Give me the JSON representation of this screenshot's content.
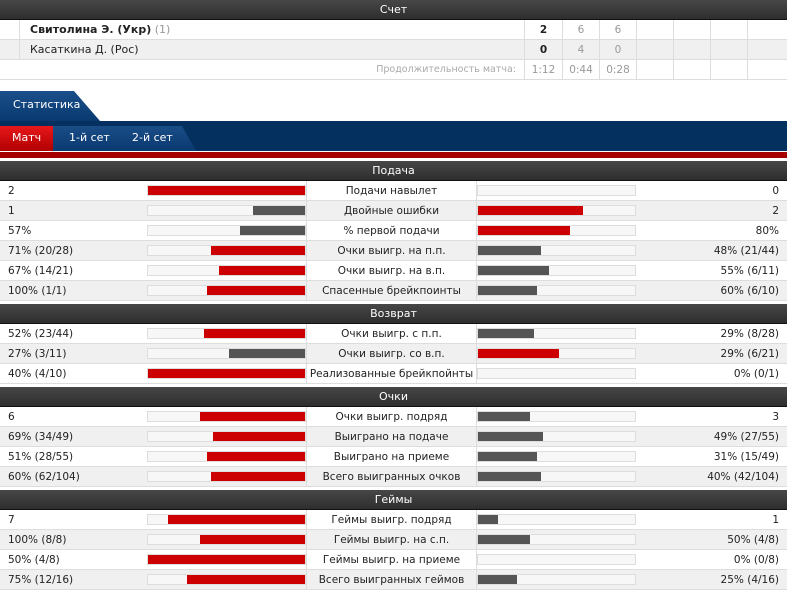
{
  "score": {
    "title": "Счет",
    "players": [
      {
        "name": "Свитолина Э. (Укр)",
        "seed": "(1)",
        "total": "2",
        "sets": [
          "6",
          "6"
        ]
      },
      {
        "name": "Касаткина Д. (Рос)",
        "seed": "",
        "total": "0",
        "sets": [
          "4",
          "0"
        ]
      }
    ],
    "duration_label": "Продолжительность матча:",
    "durations": [
      "1:12",
      "0:44",
      "0:28"
    ]
  },
  "tabs": {
    "main": "Статистика",
    "sub": [
      "Матч",
      "1-й сет",
      "2-й сет"
    ],
    "active_sub": "Матч"
  },
  "colors": {
    "winner": "#cc0000",
    "loser": "#555555"
  },
  "sections": [
    {
      "title": "Подача",
      "rows": [
        {
          "left": "2",
          "label": "Подачи навылет",
          "right": "0"
        },
        {
          "left": "1",
          "label": "Двойные ошибки",
          "right": "2"
        },
        {
          "left": "57%",
          "label": "% первой подачи",
          "right": "80%"
        },
        {
          "left": "71% (20/28)",
          "label": "Очки выигр. на п.п.",
          "right": "48% (21/44)"
        },
        {
          "left": "67% (14/21)",
          "label": "Очки выигр. на в.п.",
          "right": "55% (6/11)"
        },
        {
          "left": "100% (1/1)",
          "label": "Спасенные брейкпоинты",
          "right": "60% (6/10)"
        }
      ]
    },
    {
      "title": "Возврат",
      "rows": [
        {
          "left": "52% (23/44)",
          "label": "Очки выигр. с п.п.",
          "right": "29% (8/28)"
        },
        {
          "left": "27% (3/11)",
          "label": "Очки выигр. со в.п.",
          "right": "29% (6/21)"
        },
        {
          "left": "40% (4/10)",
          "label": "Реализованные брейкпойнты",
          "right": "0% (0/1)"
        }
      ]
    },
    {
      "title": "Очки",
      "rows": [
        {
          "left": "6",
          "label": "Очки выигр. подряд",
          "right": "3"
        },
        {
          "left": "69% (34/49)",
          "label": "Выиграно на подаче",
          "right": "49% (27/55)"
        },
        {
          "left": "51% (28/55)",
          "label": "Выиграно на приеме",
          "right": "31% (15/49)"
        },
        {
          "left": "60% (62/104)",
          "label": "Всего выигранных очков",
          "right": "40% (42/104)"
        }
      ]
    },
    {
      "title": "Геймы",
      "rows": [
        {
          "left": "7",
          "label": "Геймы выигр. подряд",
          "right": "1"
        },
        {
          "left": "100% (8/8)",
          "label": "Геймы выигр. на с.п.",
          "right": "50% (4/8)"
        },
        {
          "left": "50% (4/8)",
          "label": "Геймы выигр. на приеме",
          "right": "0% (0/8)"
        },
        {
          "left": "75% (12/16)",
          "label": "Всего выигранных геймов",
          "right": "25% (4/16)"
        }
      ]
    }
  ]
}
